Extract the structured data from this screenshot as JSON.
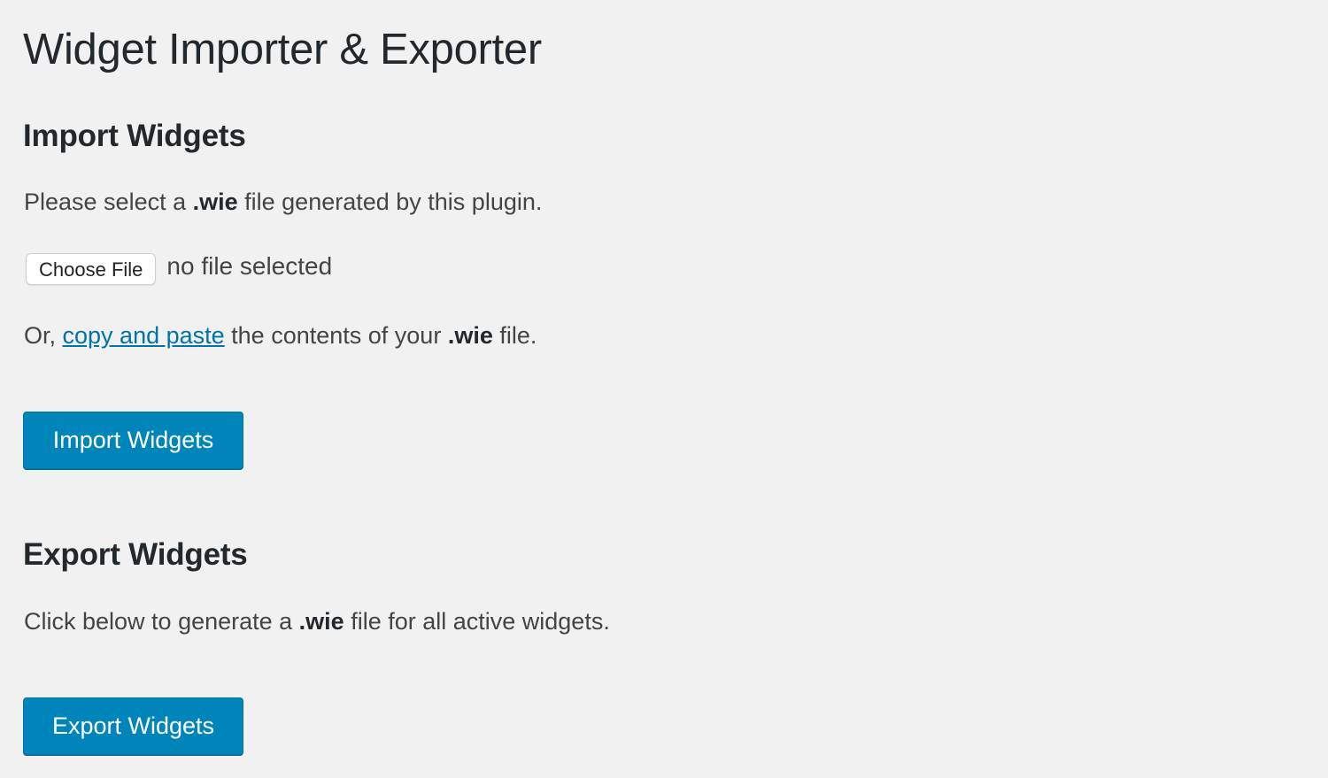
{
  "page": {
    "title": "Widget Importer & Exporter"
  },
  "import_section": {
    "heading": "Import Widgets",
    "description_prefix": "Please select a ",
    "description_ext": ".wie",
    "description_suffix": " file generated by this plugin.",
    "choose_file_label": "Choose File",
    "file_status": "no file selected",
    "paste_prefix": "Or, ",
    "paste_link": "copy and paste",
    "paste_middle": " the contents of your ",
    "paste_ext": ".wie",
    "paste_suffix": " file.",
    "button_label": "Import Widgets"
  },
  "export_section": {
    "heading": "Export Widgets",
    "description_prefix": "Click below to generate a ",
    "description_ext": ".wie",
    "description_suffix": " file for all active widgets.",
    "button_label": "Export Widgets"
  },
  "colors": {
    "background": "#f1f1f1",
    "primary_button": "#0085ba",
    "link": "#0073aa",
    "text": "#23282d"
  }
}
